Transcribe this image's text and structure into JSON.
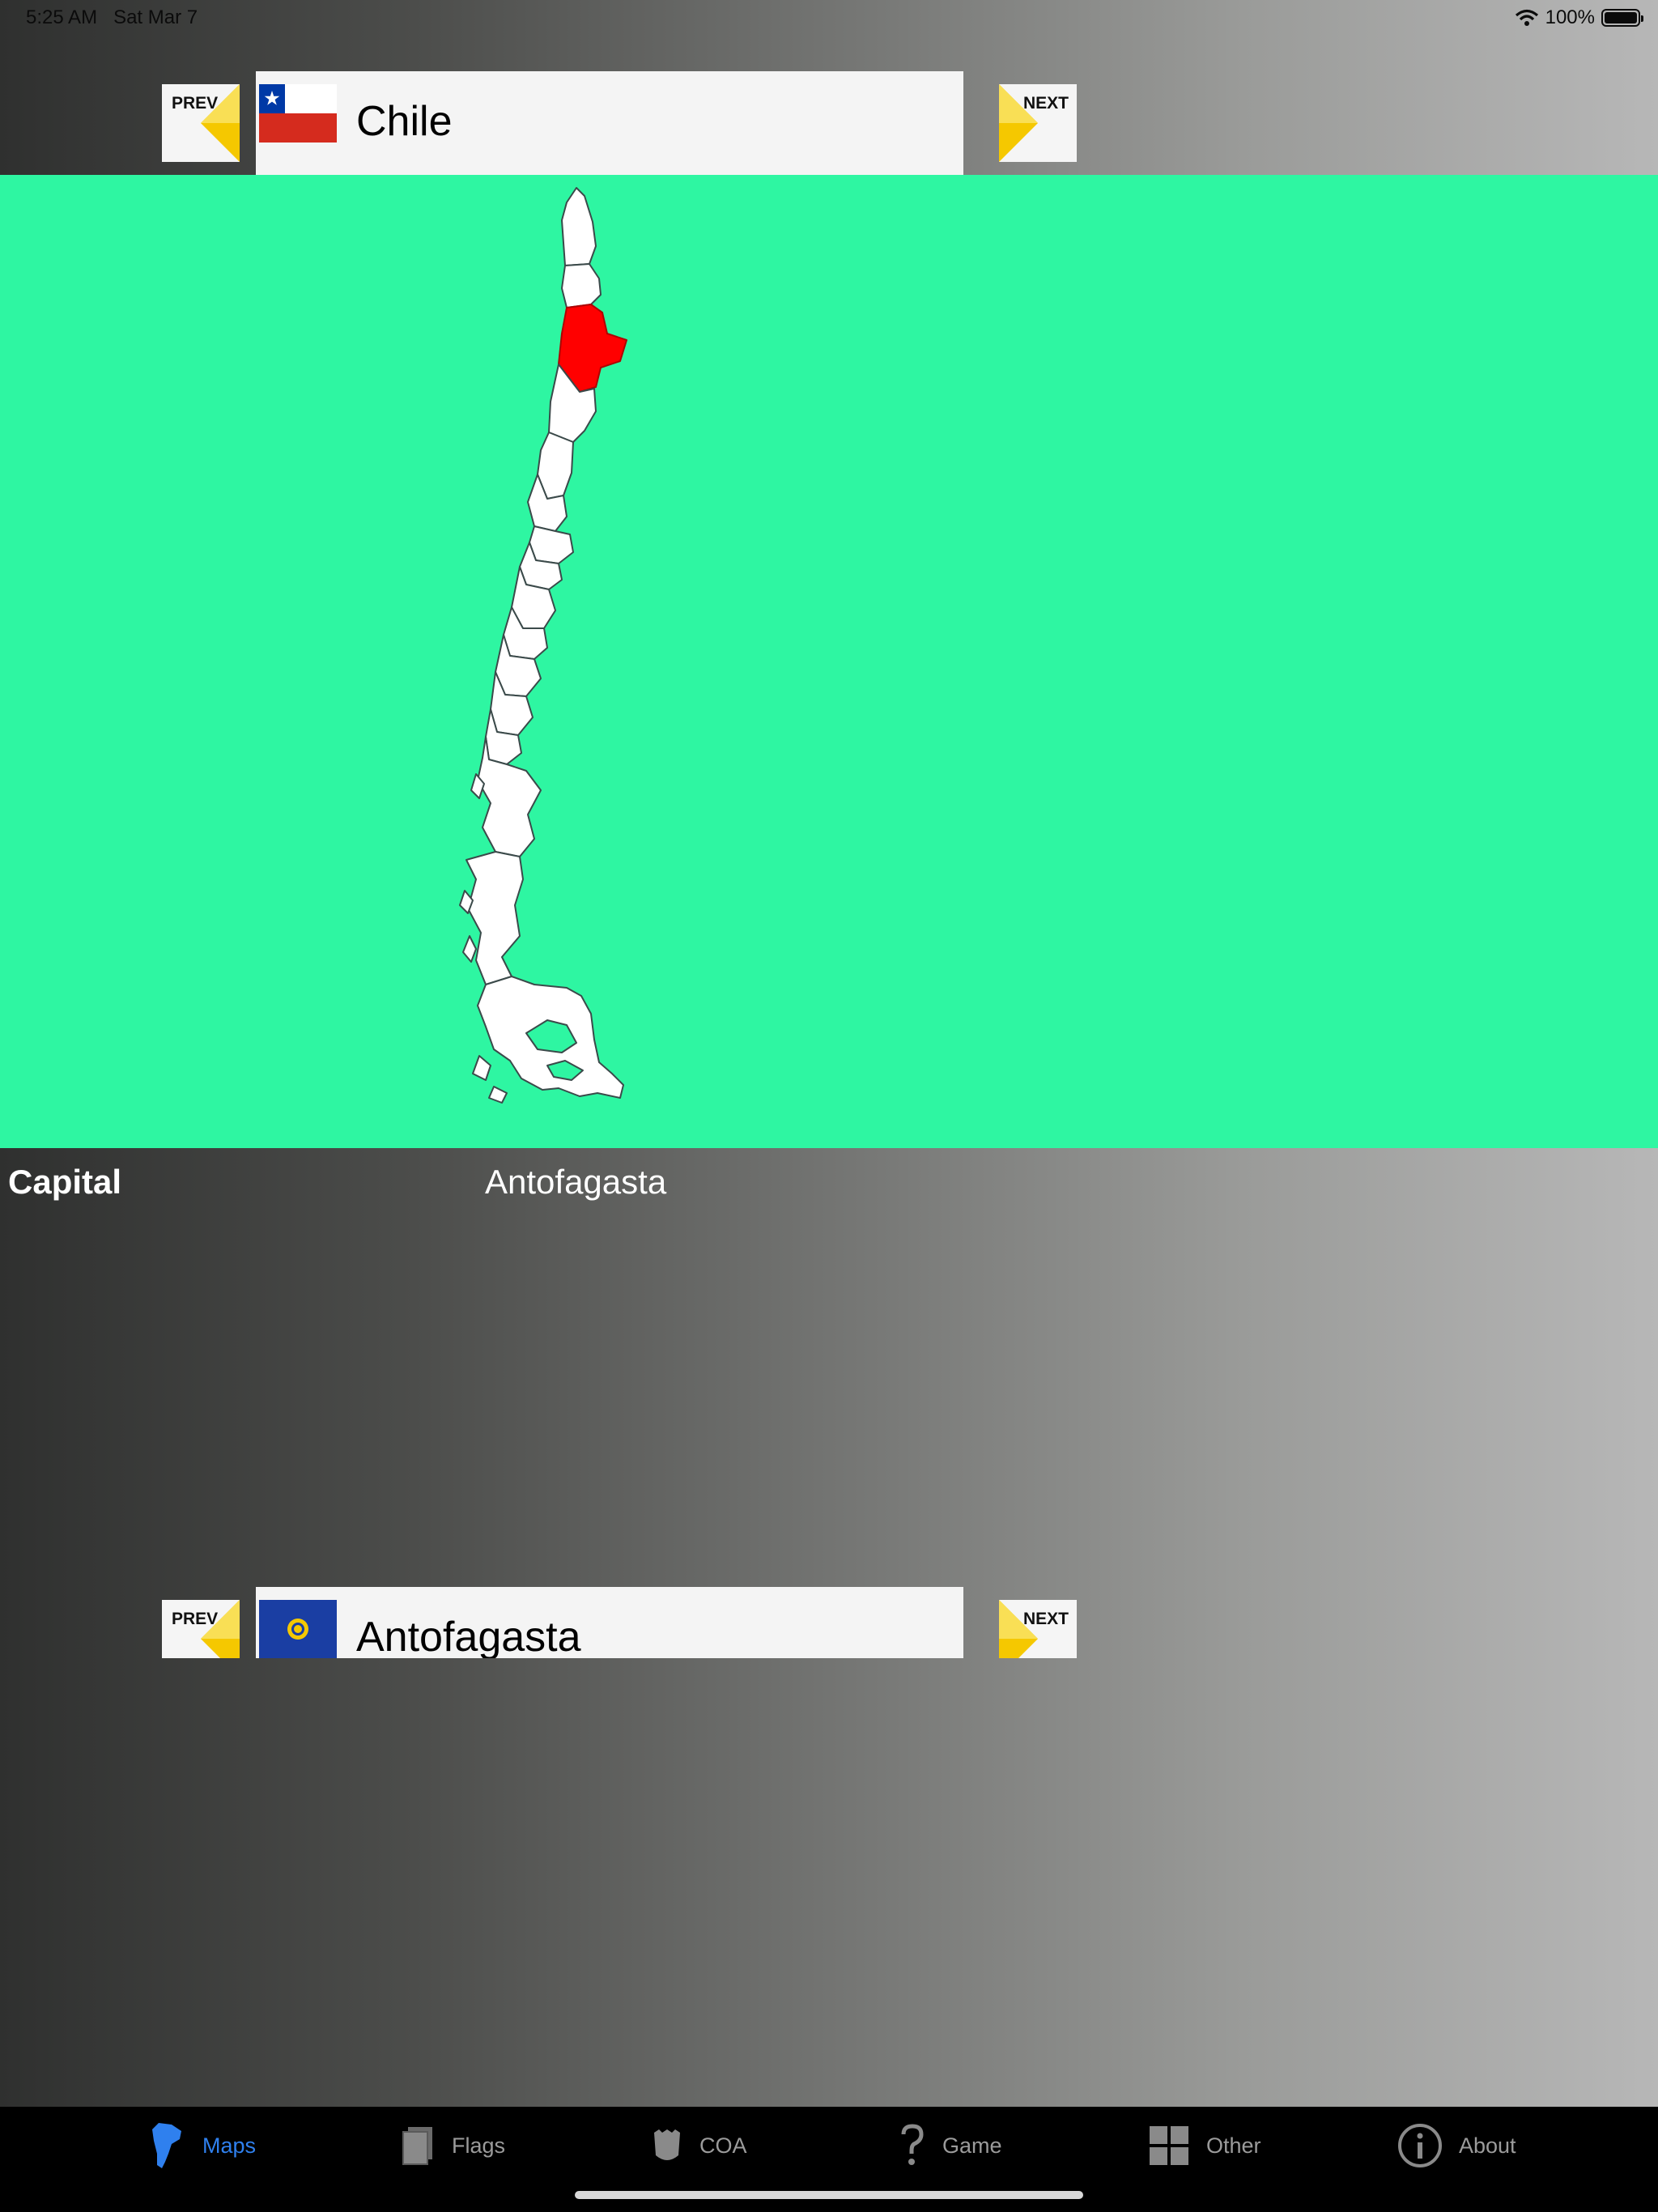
{
  "status": {
    "time": "5:25 AM",
    "date": "Sat Mar 7",
    "battery": "100%"
  },
  "nav": {
    "prev_label": "PREV",
    "next_label": "NEXT"
  },
  "country": {
    "name": "Chile"
  },
  "map": {
    "background": "#2ef6a2",
    "highlight_color": "#ff0000",
    "highlighted_region": "Antofagasta"
  },
  "capital": {
    "label": "Capital",
    "value": "Antofagasta"
  },
  "region": {
    "name": "Antofagasta"
  },
  "tabs": [
    {
      "label": "Maps",
      "icon": "map-icon",
      "active": true
    },
    {
      "label": "Flags",
      "icon": "flags-icon",
      "active": false
    },
    {
      "label": "COA",
      "icon": "shield-icon",
      "active": false
    },
    {
      "label": "Game",
      "icon": "question-icon",
      "active": false
    },
    {
      "label": "Other",
      "icon": "grid-icon",
      "active": false
    },
    {
      "label": "About",
      "icon": "info-icon",
      "active": false
    }
  ],
  "colors": {
    "active_tab": "#2f80ee",
    "inactive_tab": "#9b9b9b",
    "arrow": "#f5c800"
  }
}
